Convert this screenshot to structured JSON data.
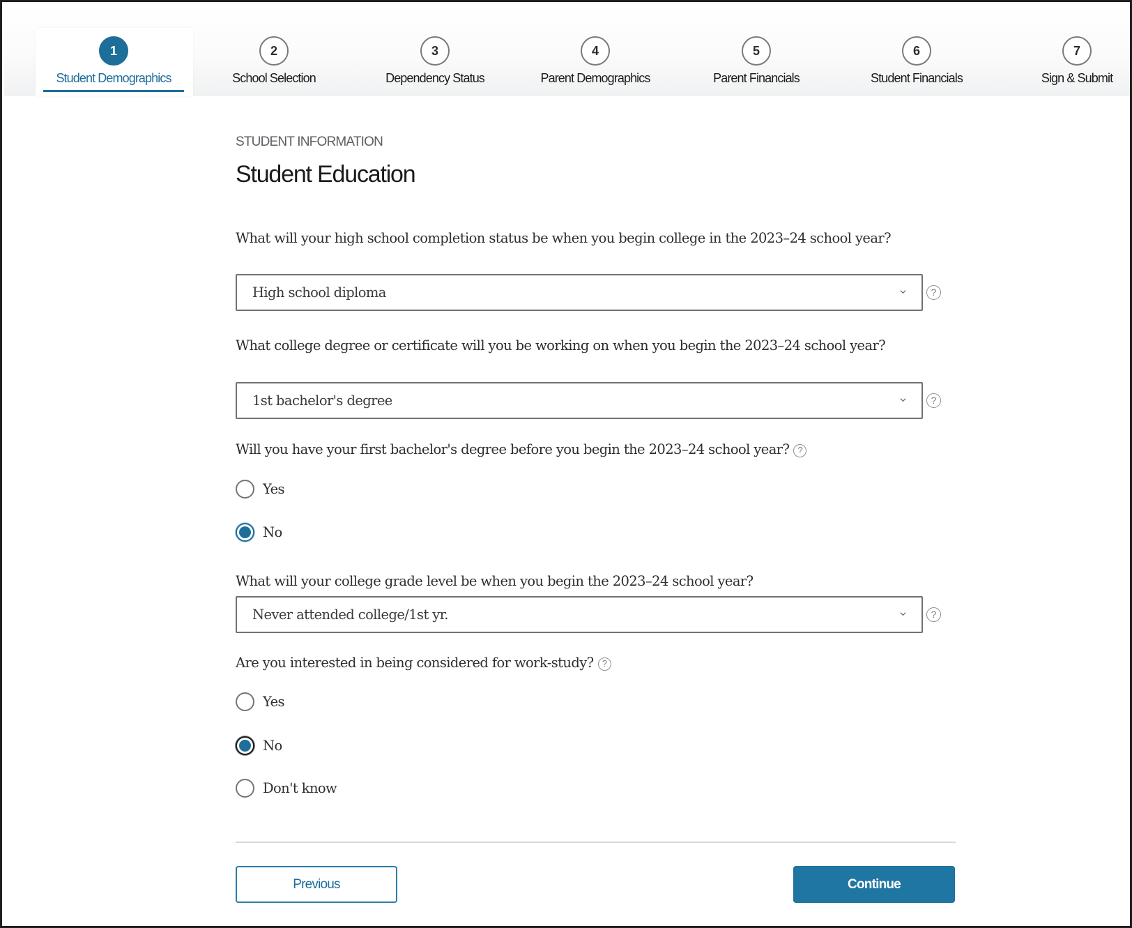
{
  "stepper": {
    "active_index": 0,
    "steps": [
      {
        "number": "1",
        "label": "Student Demographics"
      },
      {
        "number": "2",
        "label": "School Selection"
      },
      {
        "number": "3",
        "label": "Dependency Status"
      },
      {
        "number": "4",
        "label": "Parent Demographics"
      },
      {
        "number": "5",
        "label": "Parent Financials"
      },
      {
        "number": "6",
        "label": "Student Financials"
      },
      {
        "number": "7",
        "label": "Sign & Submit"
      }
    ]
  },
  "page": {
    "section_label": "STUDENT INFORMATION",
    "title": "Student Education"
  },
  "questions": {
    "hs_completion": {
      "label": "What will your high school completion status be when you begin college in the 2023–24 school year?",
      "value": "High school diploma",
      "help_icon": "question-circle"
    },
    "degree": {
      "label": "What college degree or certificate will you be working on when you begin the 2023–24 school year?",
      "value": "1st bachelor's degree",
      "help_icon": "question-circle"
    },
    "first_bachelors": {
      "label": "Will you have your first bachelor's degree before you begin the 2023–24 school year?",
      "help_icon": "question-circle",
      "options": [
        "Yes",
        "No"
      ],
      "selected": "No"
    },
    "grade_level": {
      "label": "What will your college grade level be when you begin the 2023–24 school year?",
      "value": "Never attended college/1st yr.",
      "help_icon": "question-circle"
    },
    "work_study": {
      "label": "Are you interested in being considered for work-study?",
      "help_icon": "question-circle",
      "options": [
        "Yes",
        "No",
        "Don't know"
      ],
      "selected": "No"
    }
  },
  "icons": {
    "help_glyph": "?",
    "chevron": "chevron-down"
  },
  "actions": {
    "previous_label": "Previous",
    "continue_label": "Continue"
  },
  "colors": {
    "primary": "#1e6e9a",
    "text": "#1b1b1b",
    "muted": "#5b5f63",
    "border": "#6f7275"
  }
}
